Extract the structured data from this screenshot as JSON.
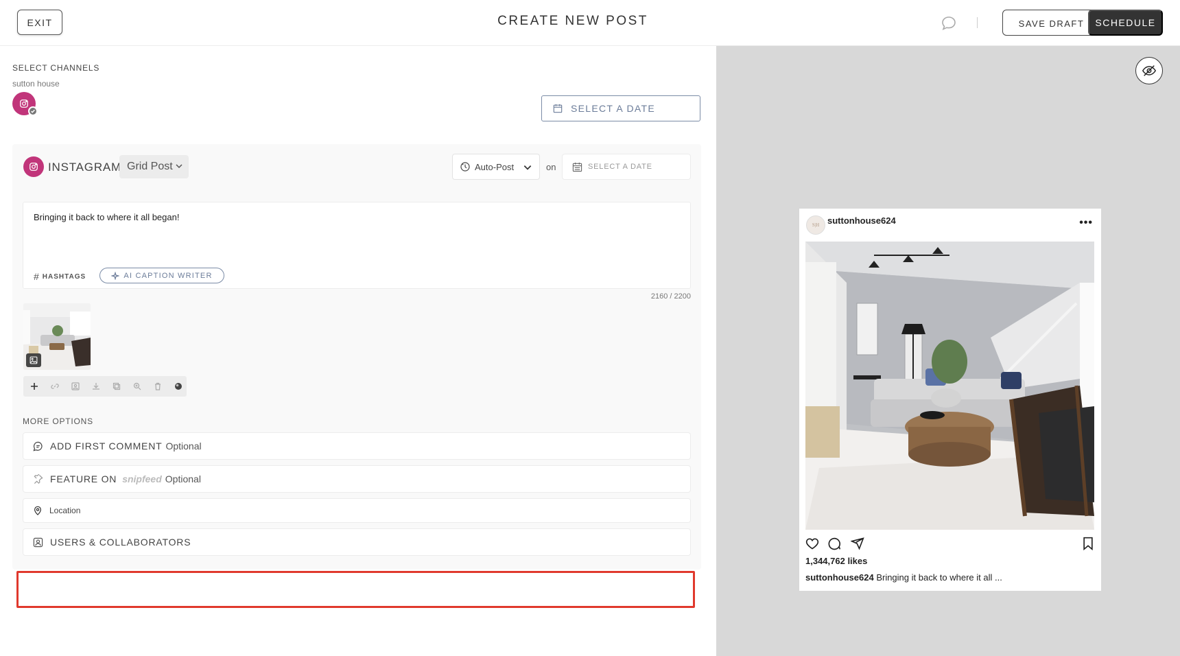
{
  "header": {
    "exit_label": "EXIT",
    "title": "CREATE NEW POST",
    "save_draft_label": "SAVE DRAFT",
    "schedule_label": "SCHEDULE"
  },
  "channels": {
    "heading": "SELECT CHANNELS",
    "account_name": "sutton house",
    "select_date_label": "SELECT A DATE"
  },
  "instagram": {
    "platform_label": "INSTAGRAM",
    "post_type": "Grid Post",
    "publish_mode": "Auto-Post",
    "on_label": "on",
    "date_placeholder": "SELECT A DATE",
    "caption": "Bringing it back to where it all began!",
    "hashtags_label": "HASHTAGS",
    "ai_caption_label": "AI CAPTION WRITER",
    "char_count": "2160 / 2200"
  },
  "more_options": {
    "heading": "MORE OPTIONS",
    "first_comment_label": "ADD FIRST COMMENT",
    "first_comment_optional": "Optional",
    "feature_label": "FEATURE ON",
    "feature_brand": "snipfeed",
    "feature_optional": "Optional",
    "location_label": "Location",
    "users_label": "USERS & COLLABORATORS"
  },
  "preview": {
    "avatar_initials": "S|H",
    "username": "suttonhouse624",
    "more_label": "•••",
    "likes": "1,344,762 likes",
    "caption_user": "suttonhouse624",
    "caption_text": "Bringing it back to where it all ..."
  },
  "colors": {
    "instagram_accent": "#c1357a",
    "highlight": "#e0392d",
    "schedule_bg": "#333333",
    "preview_panel_bg": "#d8d8d8"
  }
}
